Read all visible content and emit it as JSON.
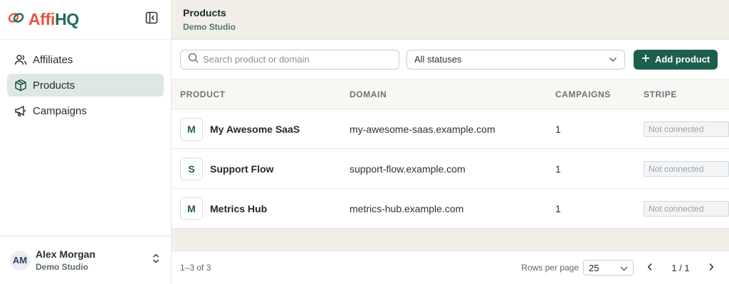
{
  "brand": {
    "logo_part1": "Affi",
    "logo_part2": "HQ",
    "colors": {
      "accent": "#e8553f",
      "brand": "#1f6b5a"
    }
  },
  "sidebar": {
    "items": [
      {
        "label": "Affiliates",
        "icon": "users-icon",
        "active": false
      },
      {
        "label": "Products",
        "icon": "box-icon",
        "active": true
      },
      {
        "label": "Campaigns",
        "icon": "megaphone-icon",
        "active": false
      }
    ],
    "user": {
      "initials": "AM",
      "name": "Alex Morgan",
      "org": "Demo Studio"
    }
  },
  "header": {
    "title": "Products",
    "subtitle": "Demo Studio"
  },
  "toolbar": {
    "search_placeholder": "Search product or domain",
    "status_value": "All statuses",
    "add_label": "Add product"
  },
  "table": {
    "headers": [
      "PRODUCT",
      "DOMAIN",
      "CAMPAIGNS",
      "STRIPE"
    ],
    "rows": [
      {
        "initial": "M",
        "name": "My Awesome SaaS",
        "domain": "my-awesome-saas.example.com",
        "campaigns": "1",
        "stripe": "Not connected"
      },
      {
        "initial": "S",
        "name": "Support Flow",
        "domain": "support-flow.example.com",
        "campaigns": "1",
        "stripe": "Not connected"
      },
      {
        "initial": "M",
        "name": "Metrics Hub",
        "domain": "metrics-hub.example.com",
        "campaigns": "1",
        "stripe": "Not connected"
      }
    ]
  },
  "footer": {
    "range": "1–3 of 3",
    "rows_per_page_label": "Rows per page",
    "rows_per_page_value": "25",
    "page_indicator": "1 / 1"
  }
}
